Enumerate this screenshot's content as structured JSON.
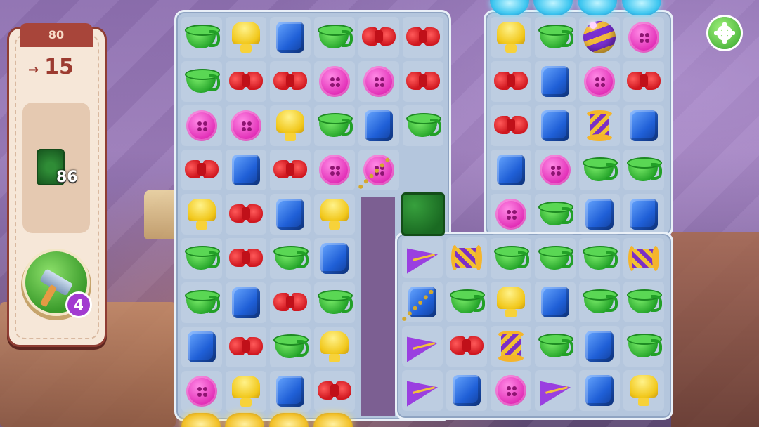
{
  "level": {
    "number": "80"
  },
  "moves": {
    "symbol": "→",
    "count": "15"
  },
  "goal": {
    "icon": "grass-tile-icon",
    "count": "86"
  },
  "booster": {
    "icon": "hammer-icon",
    "count": "4"
  },
  "settings": {
    "icon": "gear-icon"
  },
  "colors": {
    "panel": "#f6e7d8",
    "panel_border": "#8f3d33",
    "board": "#b4c6dd",
    "settings_green": "#35a52b"
  },
  "board_left": {
    "columns": 6,
    "rows": [
      [
        "cup",
        "lamp",
        "cube",
        "cup",
        "bow",
        "bow"
      ],
      [
        "cup",
        "bow",
        "bow",
        "btn",
        "btn",
        "bow"
      ],
      [
        "btn",
        "btn",
        "lamp",
        "cup",
        "cube",
        "cup"
      ],
      [
        "bow",
        "cube",
        "bow",
        "btn",
        "btn-chain",
        null
      ],
      [
        "lamp",
        "bow",
        "cube",
        "lamp",
        null,
        "grass"
      ],
      [
        "cup",
        "bow",
        "cup",
        "cube",
        null,
        null
      ],
      [
        "cup",
        "cube",
        "bow",
        "cup",
        null,
        null
      ],
      [
        "cube",
        "bow",
        "cup",
        "lamp",
        null,
        null
      ],
      [
        "btn",
        "lamp",
        "cube",
        "bow",
        null,
        null
      ]
    ]
  },
  "board_right": {
    "columns": 4,
    "rows": [
      [
        "lamp",
        "cup",
        "ball",
        "btn"
      ],
      [
        "bow",
        "cube",
        "btn",
        "bow"
      ],
      [
        "bow",
        "cube",
        "spool",
        "cube"
      ],
      [
        "cube",
        "btn",
        "cup",
        "cup"
      ],
      [
        "btn",
        "cup",
        "cube",
        "cube"
      ],
      [
        "cup",
        "cup",
        "cup",
        "spool-h"
      ]
    ]
  },
  "board_bottom": {
    "columns": 6,
    "rows": [
      [
        "plane",
        "spool-h",
        null,
        null,
        null,
        null
      ],
      [
        "cube-chain",
        "cup",
        "lamp",
        "cube",
        "cup",
        "cup"
      ],
      [
        "plane",
        "bow",
        "spool",
        "cup",
        "cube",
        "cup"
      ],
      [
        "plane",
        "cube",
        "btn",
        "plane",
        "cube",
        "lamp"
      ]
    ]
  }
}
